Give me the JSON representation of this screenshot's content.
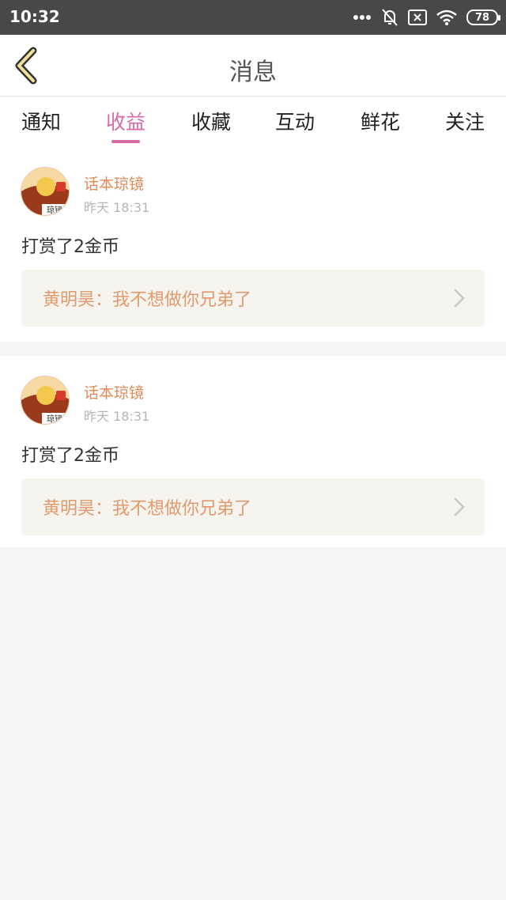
{
  "status_bar": {
    "time": "10:32",
    "battery": "78",
    "icons": [
      "more-dots-icon",
      "bell-off-icon",
      "sim-x-icon",
      "wifi-icon",
      "battery-icon"
    ]
  },
  "header": {
    "title": "消息",
    "back_icon": "chevron-left-icon"
  },
  "tabs": [
    {
      "label": "通知"
    },
    {
      "label": "收益"
    },
    {
      "label": "收藏"
    },
    {
      "label": "互动"
    },
    {
      "label": "鲜花"
    },
    {
      "label": "关注"
    }
  ],
  "active_tab": "收益",
  "colors": {
    "accent": "#d96aa8",
    "username": "#e28a55",
    "ref_text": "#e29a6c",
    "statusbar": "#484848"
  },
  "items": [
    {
      "avatar_text": "琼镜",
      "username": "话本琼镜",
      "time": "昨天 18:31",
      "action": "打赏了2金币",
      "reference": "黄明昊：我不想做你兄弟了"
    },
    {
      "avatar_text": "琼镜",
      "username": "话本琼镜",
      "time": "昨天 18:31",
      "action": "打赏了2金币",
      "reference": "黄明昊：我不想做你兄弟了"
    }
  ]
}
